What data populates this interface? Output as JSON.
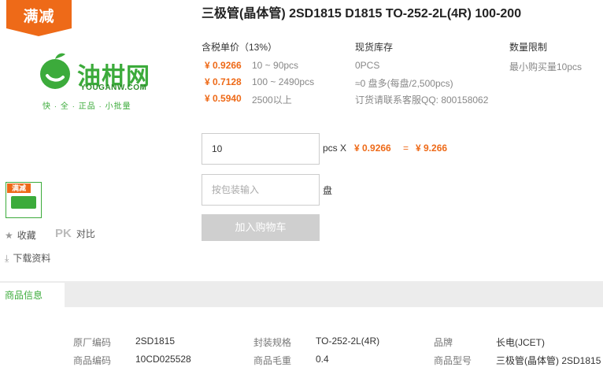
{
  "promo": {
    "label": "满减",
    "color": "#ee6a18"
  },
  "logo": {
    "name": "油柑网",
    "domain": "YOUGANW.COM",
    "slogan": "快 · 全 · 正品 · 小批量"
  },
  "thumb": {
    "badge": "满减"
  },
  "side_actions": {
    "favorite": "收藏",
    "pk_badge": "PK",
    "compare": "对比",
    "download": "下载资料"
  },
  "product": {
    "title": "三极管(晶体管) 2SD1815 D1815 TO-252-2L(4R) 100-200"
  },
  "pricing": {
    "header": "含税单价（13%）",
    "tiers": [
      {
        "price": "¥ 0.9266",
        "range": "10 ~ 90pcs"
      },
      {
        "price": "¥ 0.7128",
        "range": "100 ~ 2490pcs"
      },
      {
        "price": "¥ 0.5940",
        "range": "2500以上"
      }
    ]
  },
  "stock": {
    "header": "现货库存",
    "lines": [
      "0PCS",
      "≈0 盘多(每盘/2,500pcs)",
      "订货请联系客服QQ: 800158062"
    ]
  },
  "limit": {
    "header": "数量限制",
    "text": "最小购买量10pcs"
  },
  "order": {
    "quantity_value": "10",
    "unit": "pcs X",
    "unit_price": "¥ 0.9266",
    "equals": "=",
    "total": "¥ 9.266",
    "package_placeholder": "按包装输入",
    "package_unit": "盘",
    "add_to_cart": "加入购物车"
  },
  "tabs": {
    "active": "商品信息"
  },
  "info": {
    "rows": [
      [
        {
          "label": "原厂编码",
          "value": "2SD1815"
        },
        {
          "label": "封装规格",
          "value": "TO-252-2L(4R)"
        },
        {
          "label": "品牌",
          "value": "长电(JCET)"
        }
      ],
      [
        {
          "label": "商品编码",
          "value": "10CD025528"
        },
        {
          "label": "商品毛重",
          "value": "0.4"
        },
        {
          "label": "商品型号",
          "value": "三极管(晶体管) 2SD1815"
        }
      ]
    ]
  },
  "colors": {
    "accent": "#ee6a18",
    "brand_green": "#3cab3b",
    "disabled_button": "#cfcfcf"
  }
}
